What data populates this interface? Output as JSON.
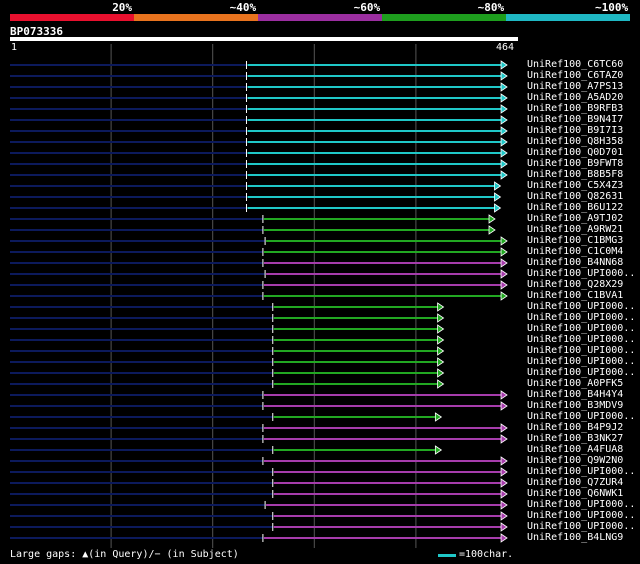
{
  "legend": {
    "segments": [
      {
        "label": "20%",
        "color": "#e8102e"
      },
      {
        "label": "~40%",
        "color": "#e8731e"
      },
      {
        "label": "~60%",
        "color": "#9b2ea0"
      },
      {
        "label": "~80%",
        "color": "#1e9e1e"
      },
      {
        "label": "~100%",
        "color": "#1fb8c4"
      }
    ]
  },
  "query": {
    "name": "BP073336",
    "start": "1",
    "end": "464",
    "length": 464
  },
  "colors": {
    "cyan": "#1fc7c7",
    "green": "#22a822",
    "purple": "#a63cab",
    "backbone": "#0c1a5c",
    "grid": "#555555"
  },
  "hits": [
    {
      "name": "UniRef100_C6TC60",
      "color": "cyan",
      "start": 216,
      "end": 454
    },
    {
      "name": "UniRef100_C6TAZ0",
      "color": "cyan",
      "start": 216,
      "end": 454
    },
    {
      "name": "UniRef100_A7PS13",
      "color": "cyan",
      "start": 216,
      "end": 454
    },
    {
      "name": "UniRef100_A5AD20",
      "color": "cyan",
      "start": 216,
      "end": 454
    },
    {
      "name": "UniRef100_B9RFB3",
      "color": "cyan",
      "start": 216,
      "end": 454
    },
    {
      "name": "UniRef100_B9N4I7",
      "color": "cyan",
      "start": 216,
      "end": 454
    },
    {
      "name": "UniRef100_B9I7I3",
      "color": "cyan",
      "start": 216,
      "end": 454
    },
    {
      "name": "UniRef100_Q8H358",
      "color": "cyan",
      "start": 216,
      "end": 454
    },
    {
      "name": "UniRef100_Q0D701",
      "color": "cyan",
      "start": 216,
      "end": 454
    },
    {
      "name": "UniRef100_B9FWT8",
      "color": "cyan",
      "start": 216,
      "end": 454
    },
    {
      "name": "UniRef100_B8B5F8",
      "color": "cyan",
      "start": 216,
      "end": 454
    },
    {
      "name": "UniRef100_C5X4Z3",
      "color": "cyan",
      "start": 216,
      "end": 448
    },
    {
      "name": "UniRef100_Q82631",
      "color": "cyan",
      "start": 216,
      "end": 448
    },
    {
      "name": "UniRef100_B6U122",
      "color": "cyan",
      "start": 216,
      "end": 448
    },
    {
      "name": "UniRef100_A9TJ02",
      "color": "green",
      "start": 231,
      "end": 443
    },
    {
      "name": "UniRef100_A9RW21",
      "color": "green",
      "start": 231,
      "end": 443
    },
    {
      "name": "UniRef100_C1BMG3",
      "color": "green",
      "start": 233,
      "end": 454
    },
    {
      "name": "UniRef100_C1C0M4",
      "color": "green",
      "start": 231,
      "end": 454
    },
    {
      "name": "UniRef100_B4NN68",
      "color": "purple",
      "start": 231,
      "end": 454
    },
    {
      "name": "UniRef100_UPI000..",
      "color": "purple",
      "start": 233,
      "end": 454
    },
    {
      "name": "UniRef100_Q28X29",
      "color": "purple",
      "start": 231,
      "end": 454
    },
    {
      "name": "UniRef100_C1BVA1",
      "color": "green",
      "start": 231,
      "end": 454
    },
    {
      "name": "UniRef100_UPI000..",
      "color": "green",
      "start": 240,
      "end": 396
    },
    {
      "name": "UniRef100_UPI000..",
      "color": "green",
      "start": 240,
      "end": 396
    },
    {
      "name": "UniRef100_UPI000..",
      "color": "green",
      "start": 240,
      "end": 396
    },
    {
      "name": "UniRef100_UPI000..",
      "color": "green",
      "start": 240,
      "end": 396
    },
    {
      "name": "UniRef100_UPI000..",
      "color": "green",
      "start": 240,
      "end": 396
    },
    {
      "name": "UniRef100_UPI000..",
      "color": "green",
      "start": 240,
      "end": 396
    },
    {
      "name": "UniRef100_UPI000..",
      "color": "green",
      "start": 240,
      "end": 396
    },
    {
      "name": "UniRef100_A0PFK5",
      "color": "green",
      "start": 240,
      "end": 396
    },
    {
      "name": "UniRef100_B4H4Y4",
      "color": "purple",
      "start": 231,
      "end": 454
    },
    {
      "name": "UniRef100_B3MDV9",
      "color": "purple",
      "start": 231,
      "end": 454
    },
    {
      "name": "UniRef100_UPI000..",
      "color": "green",
      "start": 240,
      "end": 394
    },
    {
      "name": "UniRef100_B4P9J2",
      "color": "purple",
      "start": 231,
      "end": 454
    },
    {
      "name": "UniRef100_B3NK27",
      "color": "purple",
      "start": 231,
      "end": 454
    },
    {
      "name": "UniRef100_A4FUA8",
      "color": "green",
      "start": 240,
      "end": 394
    },
    {
      "name": "UniRef100_Q9W2N0",
      "color": "purple",
      "start": 231,
      "end": 454
    },
    {
      "name": "UniRef100_UPI000..",
      "color": "purple",
      "start": 240,
      "end": 454
    },
    {
      "name": "UniRef100_Q7ZUR4",
      "color": "purple",
      "start": 240,
      "end": 454
    },
    {
      "name": "UniRef100_Q6NWK1",
      "color": "purple",
      "start": 240,
      "end": 454
    },
    {
      "name": "UniRef100_UPI000..",
      "color": "purple",
      "start": 233,
      "end": 454
    },
    {
      "name": "UniRef100_UPI000..",
      "color": "purple",
      "start": 240,
      "end": 454
    },
    {
      "name": "UniRef100_UPI000..",
      "color": "purple",
      "start": 240,
      "end": 454
    },
    {
      "name": "UniRef100_B4LNG9",
      "color": "purple",
      "start": 231,
      "end": 454
    }
  ],
  "footer": {
    "gaps_text": "Large gaps: ▲(in Query)/− (in Subject)",
    "scale_text": "=100char."
  }
}
